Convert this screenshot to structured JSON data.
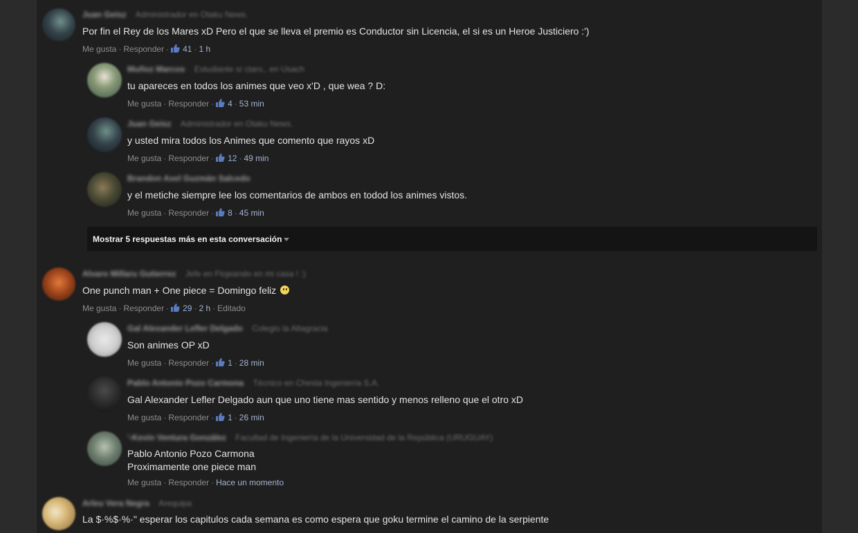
{
  "colors": {
    "panel": "#1f1f1f",
    "page": "#2a2a2a",
    "time_link": "#a8b4d4",
    "text": "#e4e4e4"
  },
  "actions": {
    "like": "Me gusta",
    "reply": "Responder",
    "separator": "·"
  },
  "threads": [
    {
      "author": "Juan Geisz",
      "subtitle": "Administrador en Otaku News.",
      "text": "Por fin el Rey de los Mares xD Pero el que se lleva el premio es Conductor sin Licencia, el si es un Heroe Justiciero :')",
      "likes": "41",
      "time": "1 h",
      "replies": [
        {
          "author": "Muñoz Marcos",
          "subtitle": "Estudiante sí claro.. en Usach",
          "text": "tu apareces en todos los animes que veo x'D , que wea ? D:",
          "likes": "4",
          "time": "53 min"
        },
        {
          "author": "Juan Geisz",
          "subtitle": "Administrador en Otaku News.",
          "text": "y usted mira todos los Animes que comento que rayos xD",
          "likes": "12",
          "time": "49 min"
        },
        {
          "author": "Brandon Axel Guzmán Salcedo",
          "subtitle": "",
          "text": "y el metiche siempre lee los comentarios de ambos en todod los animes vistos.",
          "likes": "8",
          "time": "45 min"
        }
      ],
      "more_replies": "Mostrar 5 respuestas más en esta conversación"
    },
    {
      "author": "Alvaro Millaru Gutierrez",
      "subtitle": "Jefe en Flojeando en mi casa ! :)",
      "text": "One punch man + One piece = Domingo feliz",
      "likes": "29",
      "time": "2 h",
      "edited": "Editado",
      "replies": [
        {
          "author": "Gal Alexander Lefler Delgado",
          "subtitle": "Colegio la Altagracia",
          "text": "Son animes OP xD",
          "likes": "1",
          "time": "28 min"
        },
        {
          "author": "Pablo Antonio Pozo Carmona",
          "subtitle": "Técnico en Chesta Ingeniería S.A.",
          "text": "Gal Alexander Lefler Delgado aun que uno tiene mas sentido y menos relleno que el otro xD",
          "likes": "1",
          "time": "26 min"
        },
        {
          "author": "'-Kevin Ventura González",
          "subtitle": "Facultad de Ingeniería de la Universidad de la República (URUGUAY)",
          "text_line1": "Pablo Antonio Pozo Carmona",
          "text_line2": "Proximamente one piece man",
          "time": "Hace un momento"
        }
      ]
    },
    {
      "author": "Arleu Vera Negra",
      "subtitle": "Arequipa",
      "text": "La $·%$·%·\" esperar los capitulos cada semana es como espera que goku termine el camino de la serpiente"
    }
  ]
}
